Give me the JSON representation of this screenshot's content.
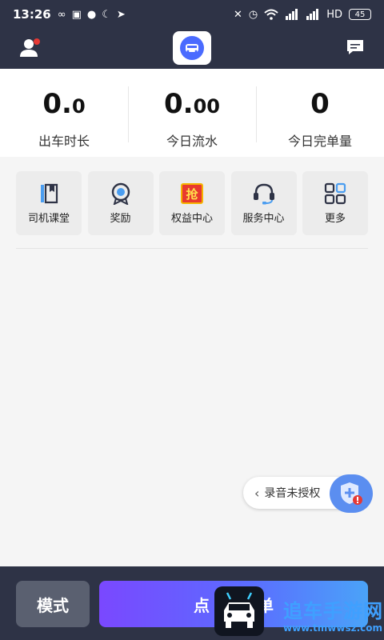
{
  "status_bar": {
    "time": "13:26",
    "battery": "45",
    "left_icons": [
      "infinity-icon",
      "app-icon",
      "chat-bubble-icon",
      "moon-icon",
      "nav-icon"
    ],
    "right_icons": [
      "mute-icon",
      "alarm-icon",
      "wifi-icon",
      "signal-icon",
      "signal-icon",
      "hd-icon"
    ]
  },
  "header": {
    "has_notification_dot": true,
    "notification_color": "#e53935"
  },
  "stats": [
    {
      "value_main": "0.",
      "value_small": "0",
      "label": "出车时长"
    },
    {
      "value_main": "0.",
      "value_small": "00",
      "label": "今日流水"
    },
    {
      "value_main": "0",
      "value_small": "",
      "label": "今日完单量"
    }
  ],
  "menu": [
    {
      "label": "司机课堂",
      "icon": "book-icon"
    },
    {
      "label": "奖励",
      "icon": "medal-icon"
    },
    {
      "label": "权益中心",
      "icon": "grab-icon",
      "icon_text": "抢"
    },
    {
      "label": "服务中心",
      "icon": "headset-icon"
    },
    {
      "label": "更多",
      "icon": "grid-icon"
    }
  ],
  "record_pill": {
    "label": "录音未授权"
  },
  "bottom": {
    "mode_label": "模式",
    "start_label": "点",
    "start_label_end": "单"
  },
  "watermark": {
    "text": "追车手游网",
    "url": "www.tmwwsz.com"
  },
  "colors": {
    "dark_bar": "#2e3346",
    "accent": "#5b6cff",
    "alert": "#e53935"
  }
}
